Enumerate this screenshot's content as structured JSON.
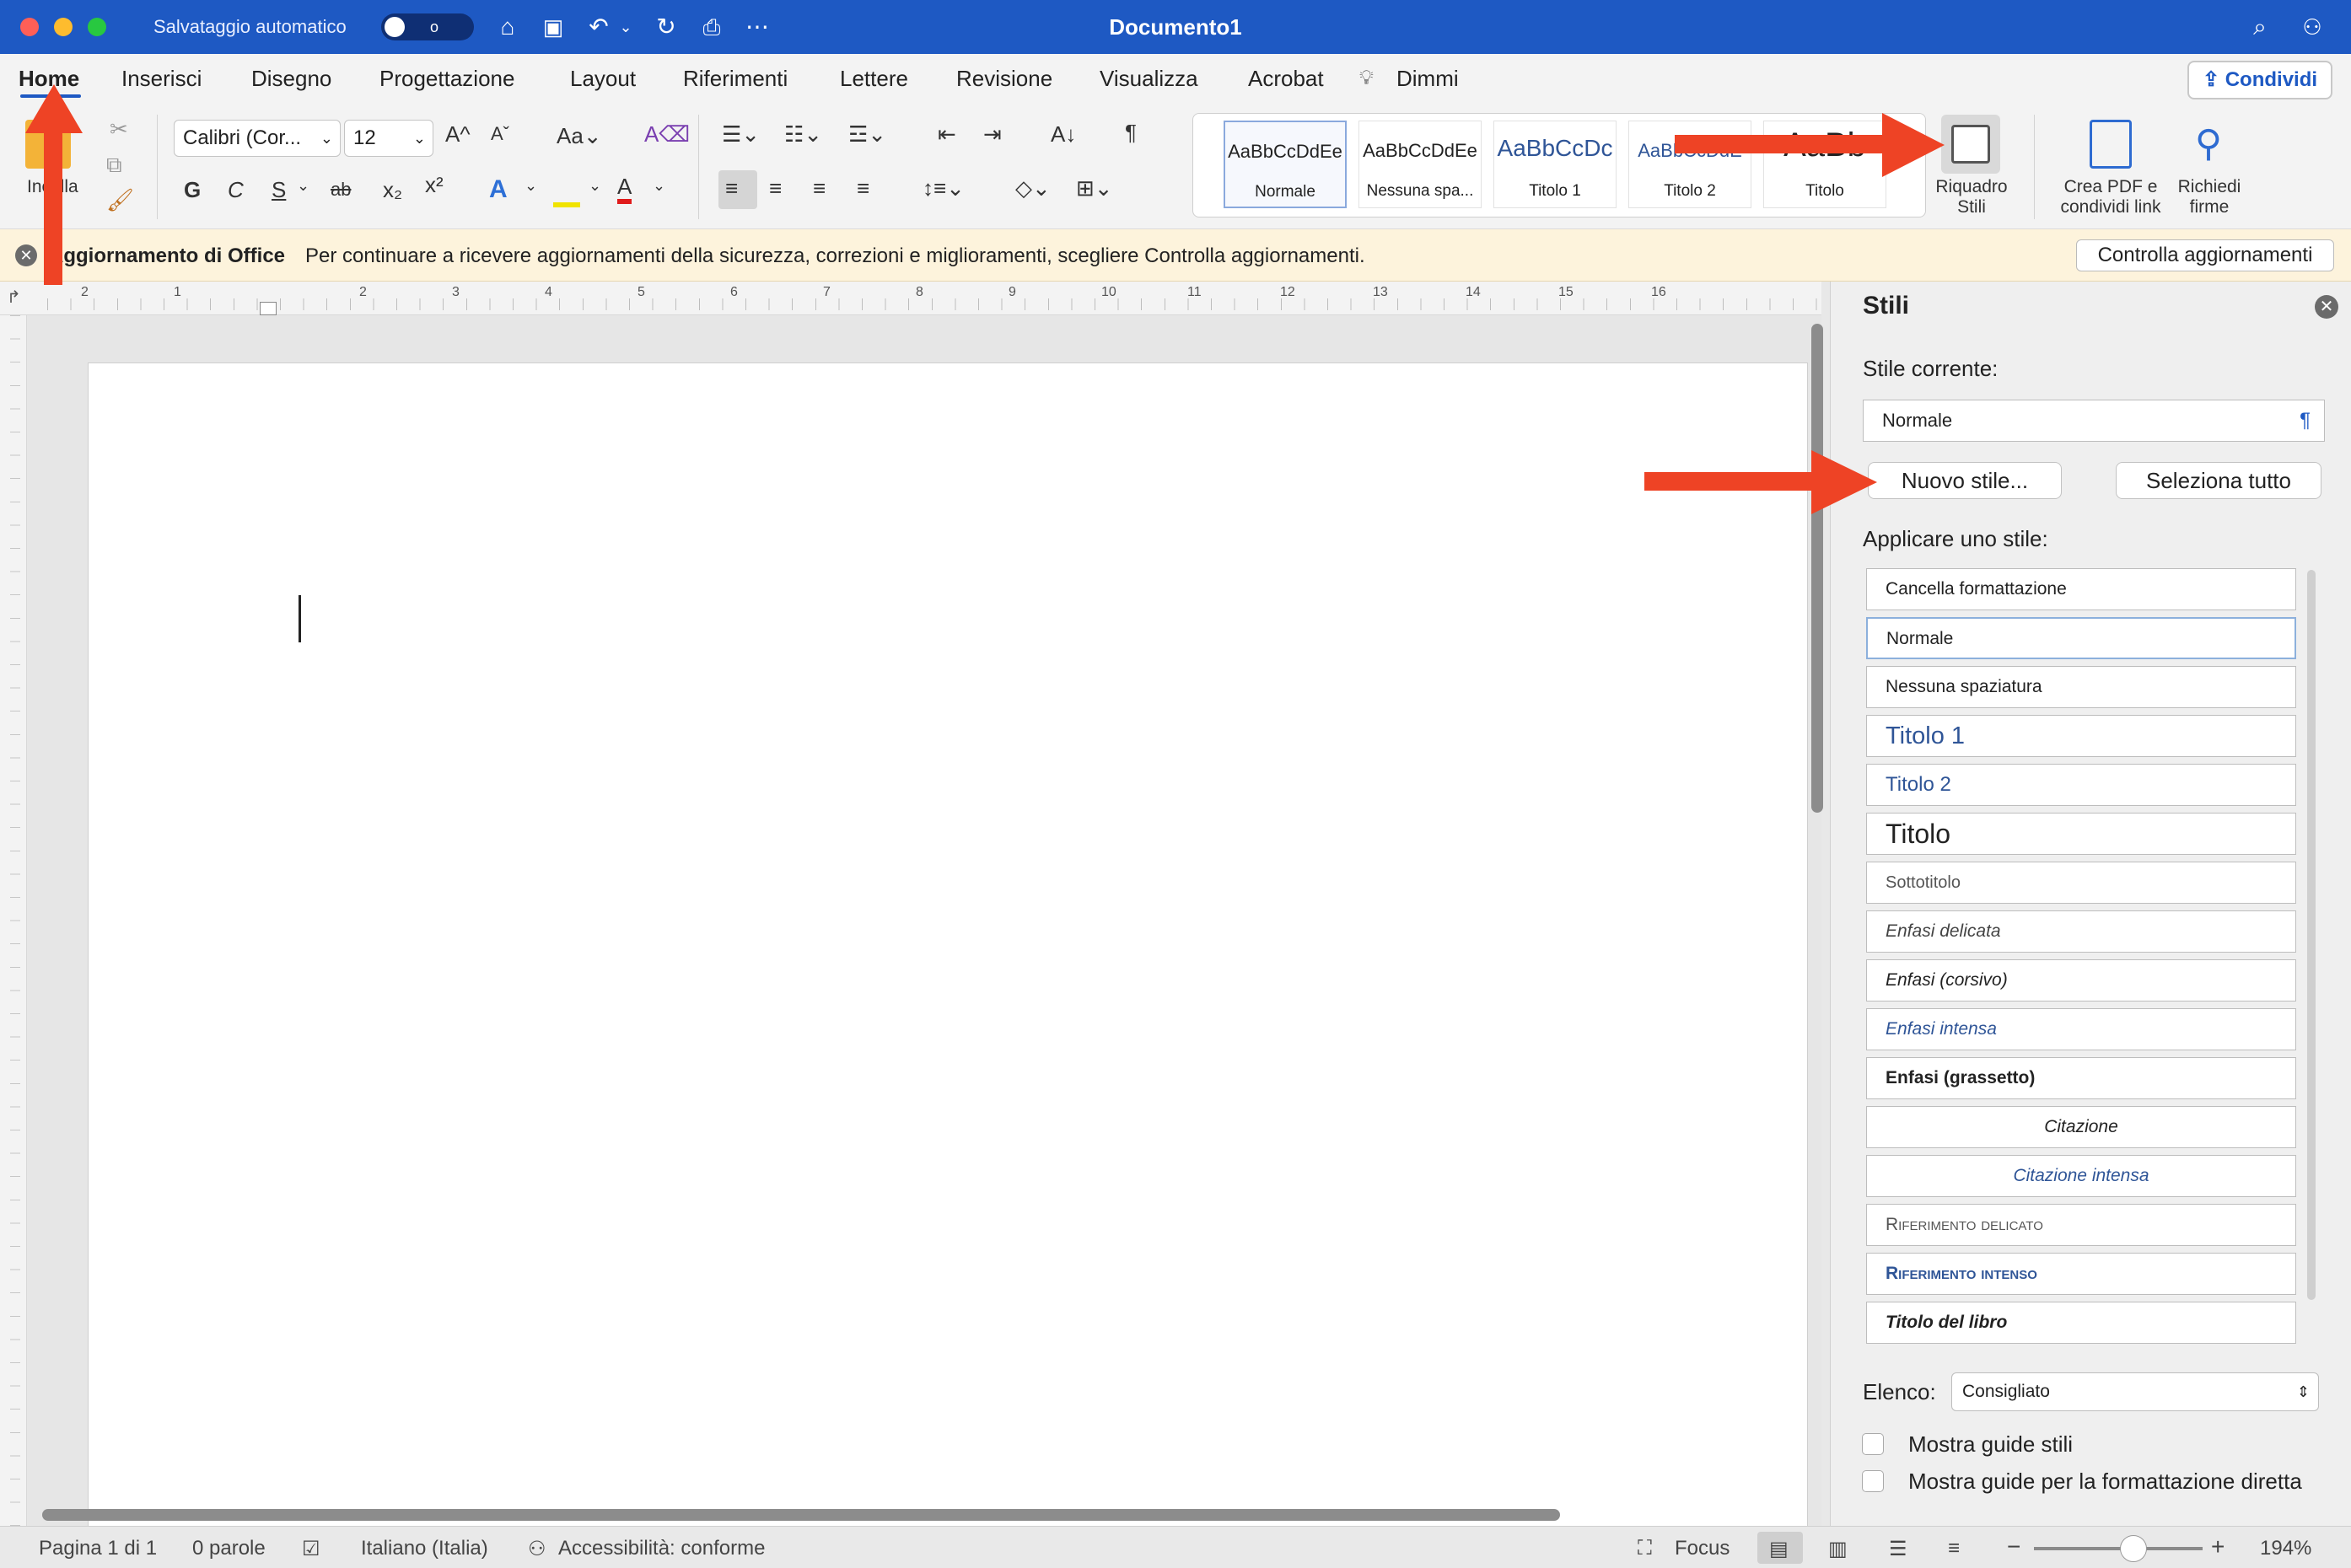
{
  "titlebar": {
    "autosave_label": "Salvataggio automatico",
    "autosave_state": "o",
    "document_title": "Documento1"
  },
  "tabs": [
    {
      "label": "Home",
      "active": true
    },
    {
      "label": "Inserisci"
    },
    {
      "label": "Disegno"
    },
    {
      "label": "Progettazione"
    },
    {
      "label": "Layout"
    },
    {
      "label": "Riferimenti"
    },
    {
      "label": "Lettere"
    },
    {
      "label": "Revisione"
    },
    {
      "label": "Visualizza"
    },
    {
      "label": "Acrobat"
    },
    {
      "label": "Dimmi"
    }
  ],
  "share_label": "Condividi",
  "ribbon": {
    "paste_label": "Incolla",
    "font_name": "Calibri (Cor...",
    "font_size": "12",
    "bold": "G",
    "italic": "C",
    "underline": "S",
    "strike": "ab",
    "style_gallery": [
      {
        "preview": "AaBbCcDdEe",
        "label": "Normale",
        "selected": true
      },
      {
        "preview": "AaBbCcDdEe",
        "label": "Nessuna spa..."
      },
      {
        "preview": "AaBbCcDc",
        "label": "Titolo 1"
      },
      {
        "preview": "AaBbCcDdE",
        "label": "Titolo 2"
      },
      {
        "preview": "AaBb",
        "label": "Titolo"
      }
    ],
    "styles_pane_label_1": "Riquadro",
    "styles_pane_label_2": "Stili",
    "pdf_label_1": "Crea PDF e",
    "pdf_label_2": "condividi link",
    "sign_label_1": "Richiedi",
    "sign_label_2": "firme"
  },
  "notification": {
    "title": "Aggiornamento di Office",
    "message": "Per continuare a ricevere aggiornamenti della sicurezza, correzioni e miglioramenti, scegliere Controlla aggiornamenti.",
    "button": "Controlla aggiornamenti"
  },
  "ruler": [
    "2",
    "1",
    "1",
    "2",
    "3",
    "4",
    "5",
    "6",
    "7",
    "8",
    "9",
    "10",
    "11",
    "12",
    "13",
    "14",
    "15",
    "16"
  ],
  "pane": {
    "title": "Stili",
    "current_style_label": "Stile corrente:",
    "current_style": "Normale",
    "new_style_button": "Nuovo stile...",
    "select_all_button": "Seleziona tutto",
    "apply_label": "Applicare uno stile:",
    "styles": [
      "Cancella formattazione",
      "Normale",
      "Nessuna spaziatura",
      "Titolo 1",
      "Titolo 2",
      "Titolo",
      "Sottotitolo",
      "Enfasi delicata",
      "Enfasi (corsivo)",
      "Enfasi intensa",
      "Enfasi (grassetto)",
      "Citazione",
      "Citazione intensa",
      "Riferimento delicato",
      "Riferimento intenso",
      "Titolo del libro"
    ],
    "list_label": "Elenco:",
    "list_value": "Consigliato",
    "show_guides": "Mostra guide stili",
    "show_direct_guides": "Mostra guide per la formattazione diretta"
  },
  "status": {
    "page": "Pagina 1 di 1",
    "words": "0 parole",
    "language": "Italiano (Italia)",
    "accessibility": "Accessibilità: conforme",
    "focus": "Focus",
    "zoom": "194%"
  },
  "colors": {
    "brand": "#1e59c3",
    "arrow": "#ee4325"
  }
}
